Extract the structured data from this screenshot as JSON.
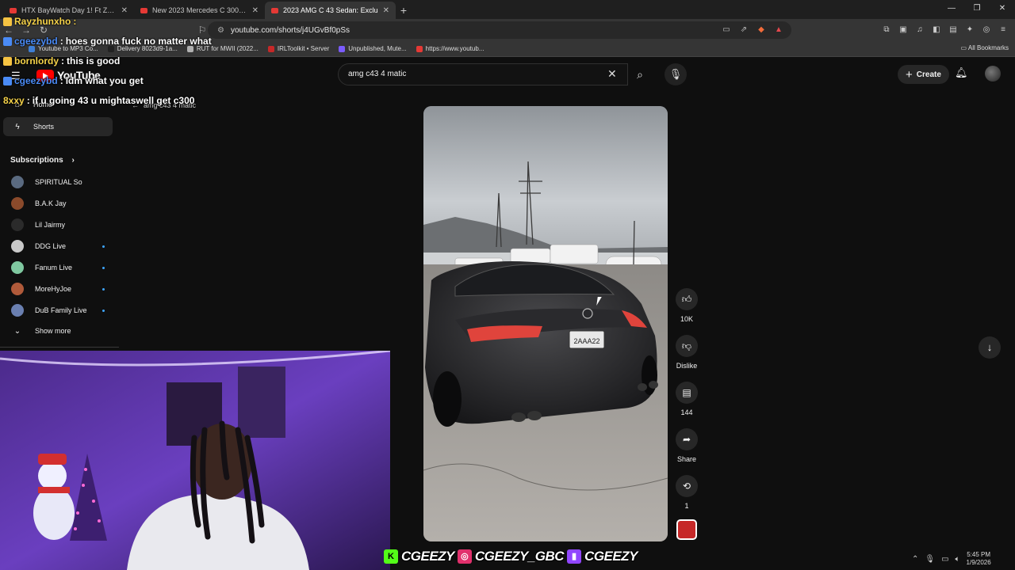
{
  "browser": {
    "tabs": [
      {
        "title": "HTX BayWatch Day 1! Ft Zaayonyt - Y",
        "active": false
      },
      {
        "title": "New 2023 Mercedes C 300 4MATIC",
        "active": false
      },
      {
        "title": "2023 AMG C 43 Sedan: Exclu",
        "active": true
      }
    ],
    "url": "youtube.com/shorts/j4UGvBf0pSs",
    "bookmarks": [
      "Youtube to MP3 Co...",
      "Delivery 8023d9-1a...",
      "RUT for MWII (2022...",
      "IRLToolkit • Server",
      "Unpublished, Mute...",
      "https://www.youtub..."
    ],
    "all_bookmarks": "All Bookmarks"
  },
  "youtube": {
    "logo": "YouTube",
    "search_query": "amg c43 4 matic",
    "create_label": "Create",
    "results_label": "amg c43 4 matic",
    "sidebar": {
      "home": "Home",
      "shorts": "Shorts",
      "subscriptions": "Subscriptions",
      "channels": [
        {
          "name": "SPIRITUAL So",
          "live": false,
          "color": "#5a6a80"
        },
        {
          "name": "B.A.K Jay",
          "live": false,
          "color": "#8b4a2b"
        },
        {
          "name": "Lil Jairmy",
          "live": false,
          "color": "#2b2b2b"
        },
        {
          "name": "DDG Live",
          "live": true,
          "color": "#c9c9c9"
        },
        {
          "name": "Fanum Live",
          "live": true,
          "color": "#7fc8a0"
        },
        {
          "name": "MoreHyJoe",
          "live": true,
          "color": "#b05a3a"
        },
        {
          "name": "DuB Family Live",
          "live": true,
          "color": "#6a7fb0"
        }
      ],
      "show_more": "Show more"
    },
    "actions": {
      "likes": "10K",
      "dislike": "Dislike",
      "comments": "144",
      "share": "Share",
      "remix": "1"
    },
    "plate": "2AAA22"
  },
  "chat": [
    {
      "user": "Rayzhunxho",
      "message": "",
      "color": "#f6d34a"
    },
    {
      "user": "cgeezybd",
      "message": "hoes gonna fuck no matter what",
      "color": "#4a8bf6"
    },
    {
      "user": "bornlordy",
      "message": "this is good",
      "color": "#f6d34a"
    },
    {
      "user": "cgeezybd",
      "message": "ldm what you get",
      "color": "#4a8bf6"
    },
    {
      "user": "8xxy",
      "message": "if u going 43 u mightaswell get c300",
      "color": "#f6d34a"
    }
  ],
  "stream_banner": [
    "CGEEZY",
    "CGEEZY_GBC",
    "CGEEZY"
  ],
  "tray": {
    "time": "5:45 PM",
    "date": "1/9/2026"
  },
  "colors": {
    "brand_red": "#ff0000",
    "kick_green": "#53fc18",
    "instagram_pink": "#e1306c",
    "twitch_purple": "#9146ff",
    "live_dot": "#3ea6ff"
  }
}
